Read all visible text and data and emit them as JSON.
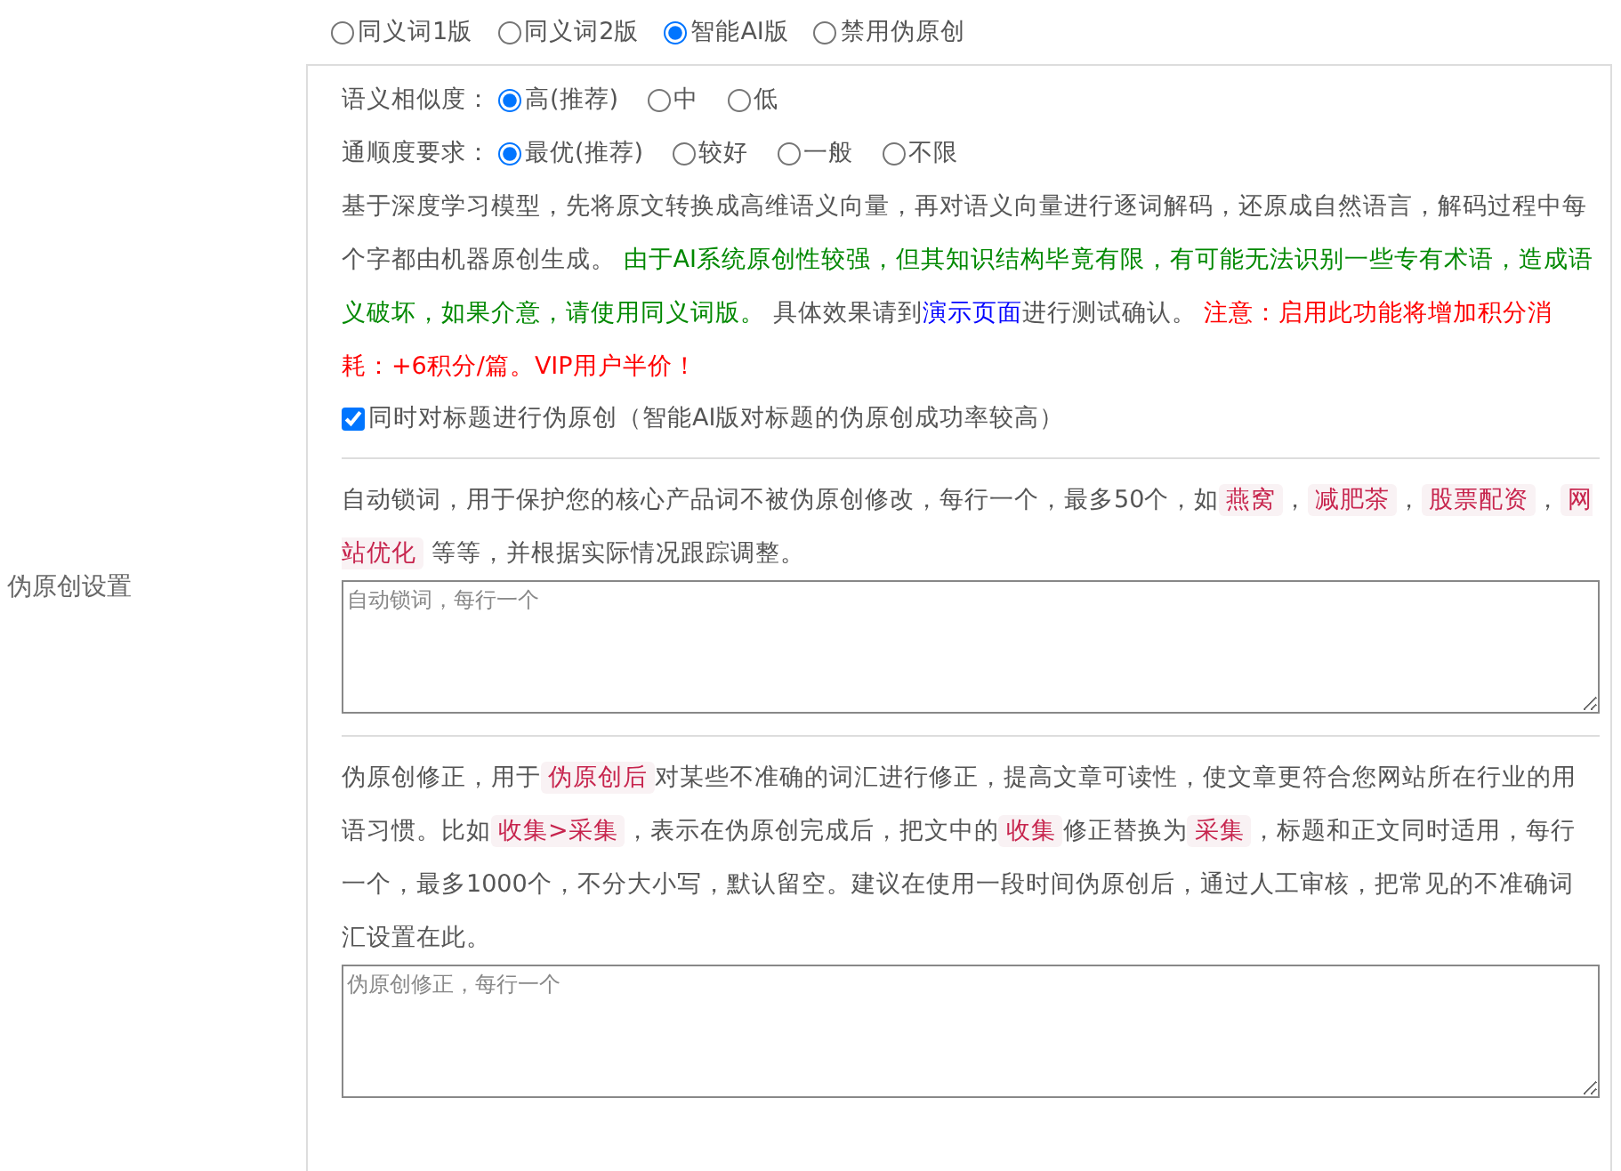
{
  "section_label": "伪原创设置",
  "modes": [
    {
      "label": "同义词1版",
      "selected": false
    },
    {
      "label": "同义词2版",
      "selected": false
    },
    {
      "label": "智能AI版",
      "selected": true
    },
    {
      "label": "禁用伪原创",
      "selected": false
    }
  ],
  "ai_settings": {
    "similarity": {
      "label": "语义相似度：",
      "options": [
        {
          "label": "高(推荐)",
          "selected": true
        },
        {
          "label": "中",
          "selected": false
        },
        {
          "label": "低",
          "selected": false
        }
      ]
    },
    "fluency": {
      "label": "通顺度要求：",
      "options": [
        {
          "label": "最优(推荐)",
          "selected": true
        },
        {
          "label": "较好",
          "selected": false
        },
        {
          "label": "一般",
          "selected": false
        },
        {
          "label": "不限",
          "selected": false
        }
      ]
    },
    "description": [
      {
        "kind": "plain",
        "text": "基于深度学习模型，先将原文转换成高维语义向量，再对语义向量进行逐词解码，还原成自然语言，解码过程中每个字都由机器原创生成。 "
      },
      {
        "kind": "green",
        "text": "由于AI系统原创性较强，但其知识结构毕竟有限，有可能无法识别一些专有术语，造成语义破坏，如果介意，请使用同义词版。"
      },
      {
        "kind": "plain",
        "text": " 具体效果请到"
      },
      {
        "kind": "link",
        "text": "演示页面"
      },
      {
        "kind": "plain",
        "text": "进行测试确认。 "
      },
      {
        "kind": "red",
        "text": "注意：启用此功能将增加积分消耗：+6积分/篇。VIP用户半价！"
      }
    ],
    "title_option": {
      "label": "同时对标题进行伪原创（智能AI版对标题的伪原创成功率较高）",
      "checked": true
    }
  },
  "lock_words": {
    "description": [
      {
        "kind": "plain",
        "text": "自动锁词，用于保护您的核心产品词不被伪原创修改，每行一个，最多50个，如"
      },
      {
        "kind": "tag",
        "text": "燕窝"
      },
      {
        "kind": "plain",
        "text": "，"
      },
      {
        "kind": "tag",
        "text": "减肥茶"
      },
      {
        "kind": "plain",
        "text": "，"
      },
      {
        "kind": "tag",
        "text": "股票配资"
      },
      {
        "kind": "plain",
        "text": "，"
      },
      {
        "kind": "tag",
        "text": "网站优化"
      },
      {
        "kind": "plain",
        "text": " 等等，并根据实际情况跟踪调整。"
      }
    ],
    "placeholder": "自动锁词，每行一个"
  },
  "corrections": {
    "description": [
      {
        "kind": "plain",
        "text": "伪原创修正，用于"
      },
      {
        "kind": "tag",
        "text": "伪原创后"
      },
      {
        "kind": "plain",
        "text": "对某些不准确的词汇进行修正，提高文章可读性，使文章更符合您网站所在行业的用语习惯。比如"
      },
      {
        "kind": "tag",
        "text": "收集>采集"
      },
      {
        "kind": "plain",
        "text": "，表示在伪原创完成后，把文中的"
      },
      {
        "kind": "tag",
        "text": "收集"
      },
      {
        "kind": "plain",
        "text": "修正替换为"
      },
      {
        "kind": "tag",
        "text": "采集"
      },
      {
        "kind": "plain",
        "text": "，标题和正文同时适用，每行一个，最多1000个，不分大小写，默认留空。建议在使用一段时间伪原创后，通过人工审核，把常见的不准确词汇设置在此。"
      }
    ],
    "placeholder": "伪原创修正，每行一个"
  }
}
